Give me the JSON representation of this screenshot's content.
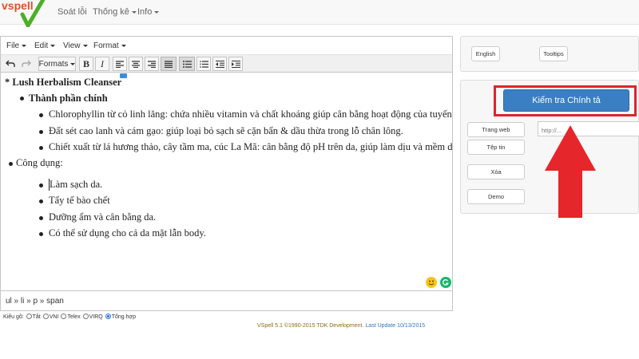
{
  "logo": {
    "text": "vspell"
  },
  "nav": {
    "items": [
      {
        "label": "Soát lỗi",
        "dropdown": false
      },
      {
        "label": "Thống kê",
        "dropdown": true
      },
      {
        "label": "Info",
        "dropdown": true
      }
    ]
  },
  "editor": {
    "menu": [
      "File",
      "Edit",
      "View",
      "Format"
    ],
    "toolbar": {
      "formats_label": "Formats",
      "icons": [
        "undo-icon",
        "redo-icon",
        "bold-icon",
        "italic-icon",
        "align-left-icon",
        "align-center-icon",
        "align-right-icon",
        "align-justify-icon",
        "bullet-list-icon",
        "numbered-list-icon",
        "outdent-icon",
        "indent-icon"
      ]
    },
    "content": {
      "heading": "Lush Herbalism Cleanser",
      "section1": "Thành phần chính",
      "ingredients": [
        "Chlorophyllin từ cỏ linh lăng: chứa nhiều vitamin và chất khoáng giúp cân bằng hoạt động của tuyến bã nhờn.",
        "Đất sét cao lanh và cám gạo: giúp loại bỏ sạch sẽ cặn bẩn & dầu thừa trong lỗ chân lông.",
        "Chiết xuất từ lá hương thảo, cây tầm ma, cúc La Mã: cân bằng độ pH trên da, giúp làm dịu và mềm da."
      ],
      "section2": "Công dụng:",
      "uses": [
        "Làm sạch da.",
        "Tẩy tế bào chết",
        "Dưỡng ẩm và cân bằng da.",
        "Có thể sử dụng cho cả da mặt lẫn body."
      ]
    },
    "status_path": "ul » li » p » span"
  },
  "input_mode": {
    "label": "Kiểu gõ:",
    "options": [
      {
        "label": "Tắt",
        "checked": false
      },
      {
        "label": "VNI",
        "checked": false
      },
      {
        "label": "Telex",
        "checked": false
      },
      {
        "label": "VIRQ",
        "checked": false
      },
      {
        "label": "Tổng hợp",
        "checked": true
      }
    ]
  },
  "footer": {
    "text": "VSpell 5.1 ©1990-2015 TDK Development.",
    "update": "Last Update 10/13/2015"
  },
  "right": {
    "language_buttons": [
      "English",
      "Tooltips"
    ],
    "check_button": "Kiểm tra Chính tả",
    "side_buttons": [
      "Trang web",
      "Tệp tin",
      "Xóa",
      "Demo"
    ],
    "url_placeholder": "http://..."
  },
  "colors": {
    "primary": "#3a7fc4",
    "highlight_red": "#d9262e",
    "logo_orange": "#d9532c",
    "logo_green": "#4caf28"
  }
}
